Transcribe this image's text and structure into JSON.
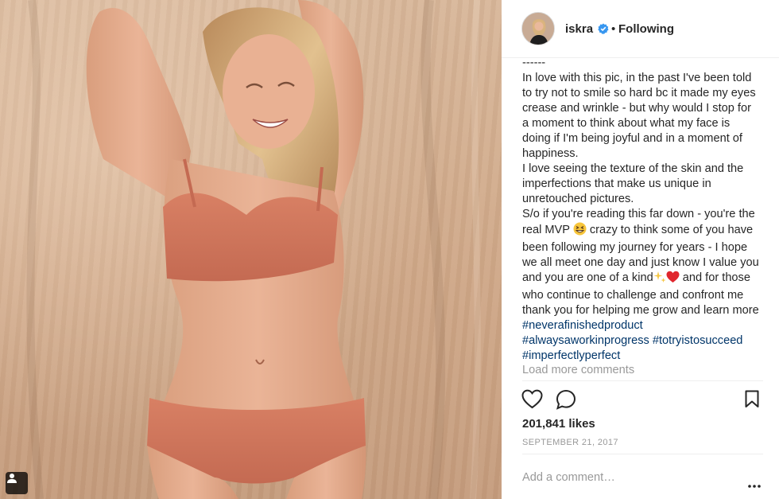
{
  "post": {
    "image_alt": "Woman in a peach bralette and briefs smiling against a beige backdrop",
    "tag_icon": "person-tag-icon"
  },
  "header": {
    "username": "iskra",
    "verified_icon": "verified-badge-icon",
    "separator": "•",
    "follow_label": "Following"
  },
  "caption": {
    "lines": [
      "------",
      "In love with this pic, in the past I've been told",
      "to try not to smile so hard bc it made my eyes",
      "crease and wrinkle - but why would I stop for",
      "a moment to think about what my face is",
      "doing if I'm being joyful and in a moment of",
      "happiness.",
      "I love seeing the texture of the skin and the",
      "imperfections that make us unique in",
      "unretouched pictures.",
      "S/o if you're reading this far down - you're the"
    ],
    "mvp_before": "real MVP",
    "mvp_after": " crazy to think some of you have",
    "lines2": [
      "been following my journey for years - I hope",
      "we all meet one day and just know I value you"
    ],
    "kind_before": "and you are one of a kind",
    "kind_after": " and for those",
    "lines3": [
      "who continue to challenge and confront me",
      "thank you for helping me grow and learn more"
    ],
    "hashtags": [
      "#neverafinishedproduct",
      "#alwaysaworkinprogress",
      "#totryistosucceed",
      "#imperfectlyperfect"
    ]
  },
  "comments": {
    "load_more": "Load more comments"
  },
  "actions": {
    "like_icon": "heart-icon",
    "comment_icon": "comment-bubble-icon",
    "save_icon": "bookmark-icon"
  },
  "stats": {
    "likes": "201,841 likes",
    "date": "SEPTEMBER 21, 2017"
  },
  "add_comment": {
    "placeholder": "Add a comment…",
    "more_icon": "more-options-icon"
  }
}
